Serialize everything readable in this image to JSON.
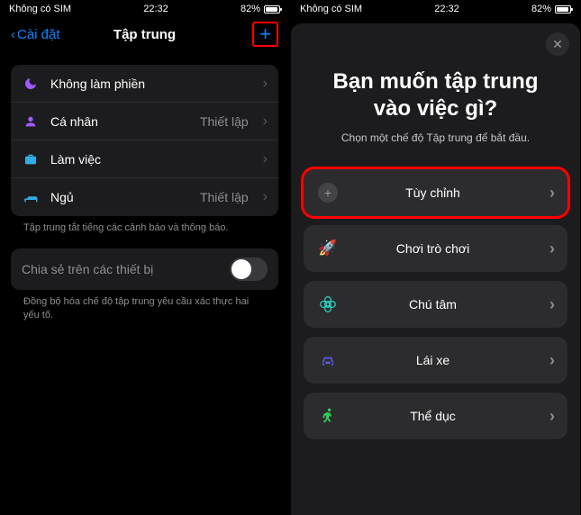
{
  "status": {
    "carrier": "Không có SIM",
    "time": "22:32",
    "battery_pct": "82%"
  },
  "screen1": {
    "back_label": "Cài đặt",
    "title": "Tập trung",
    "focus_items": [
      {
        "label": "Không làm phiền",
        "detail": "",
        "icon_name": "moon-icon",
        "icon_color": "#a259ff"
      },
      {
        "label": "Cá nhân",
        "detail": "Thiết lập",
        "icon_name": "person-icon",
        "icon_color": "#a259ff"
      },
      {
        "label": "Làm việc",
        "detail": "",
        "icon_name": "briefcase-icon",
        "icon_color": "#32ade6"
      },
      {
        "label": "Ngủ",
        "detail": "Thiết lập",
        "icon_name": "bed-icon",
        "icon_color": "#32ade6"
      }
    ],
    "footer1": "Tập trung tắt tiếng các cảnh báo và thông báo.",
    "share_label": "Chia sẻ trên các thiết bị",
    "footer2": "Đồng bộ hóa chế độ tập trung yêu cầu xác thực hai yếu tố."
  },
  "screen2": {
    "title_line1": "Bạn muốn tập trung",
    "title_line2": "vào việc gì?",
    "subtitle": "Chọn một chế độ Tập trung để bắt đầu.",
    "options": [
      {
        "label": "Tùy chỉnh",
        "icon_name": "plus-circle-icon",
        "highlight": true
      },
      {
        "label": "Chơi trò chơi",
        "icon_name": "game-icon",
        "icon_color": "#0a84ff"
      },
      {
        "label": "Chú tâm",
        "icon_name": "mindfulness-icon",
        "icon_color": "#30d0c0"
      },
      {
        "label": "Lái xe",
        "icon_name": "car-icon",
        "icon_color": "#5e5ce6"
      },
      {
        "label": "Thể dục",
        "icon_name": "fitness-icon",
        "icon_color": "#30d158"
      }
    ]
  }
}
